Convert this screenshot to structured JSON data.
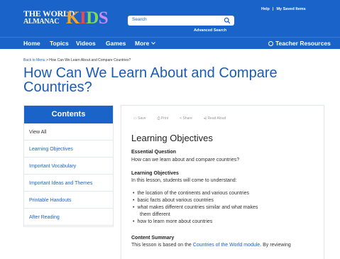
{
  "header": {
    "logo_top": "THE WORLD",
    "logo_bottom": "ALMANAC",
    "logo_kids": [
      "K",
      "I",
      "D",
      "S"
    ],
    "search_placeholder": "Search",
    "advanced_search": "Advanced Search",
    "help": "Help",
    "sep": "|",
    "my_saved_items": "My Saved Items"
  },
  "nav": {
    "items": [
      "Home",
      "Topics",
      "Videos",
      "Games",
      "More"
    ],
    "teacher_resources": "Teacher Resources"
  },
  "breadcrumb": {
    "back": "Back to Menu",
    "arrow": ">",
    "current": "How Can We Learn About and Compare Countries?"
  },
  "page_title": "How Can We Learn About and Compare Countries?",
  "contents": {
    "heading": "Contents",
    "items": [
      "View All",
      "Learning Objectives",
      "Important Vocabulary",
      "Important Ideas and Themes",
      "Printable Handouts",
      "After Reading"
    ]
  },
  "article": {
    "tools": [
      "Save",
      "Print",
      "Share",
      "Read Aloud"
    ],
    "heading": "Learning Objectives",
    "eq_label": "Essential Question",
    "eq_text": "How can we learn about and compare countries?",
    "lo_label": "Learning Objectives",
    "lo_intro": "In this lesson, students will come to understand:",
    "bullets": [
      "the location of the continents and various countries",
      "basic facts about various countries",
      "what makes different countries similar and what makes",
      "them different",
      "how to learn more about countries"
    ],
    "summary_label": "Content Summary",
    "summary_text": "This lesson is based on the ",
    "summary_link": "Countries of the World module",
    "summary_tail": ". By reviewing"
  },
  "colors": {
    "brand_blue": "#1a63c9",
    "title_blue": "#1a5bb8"
  }
}
